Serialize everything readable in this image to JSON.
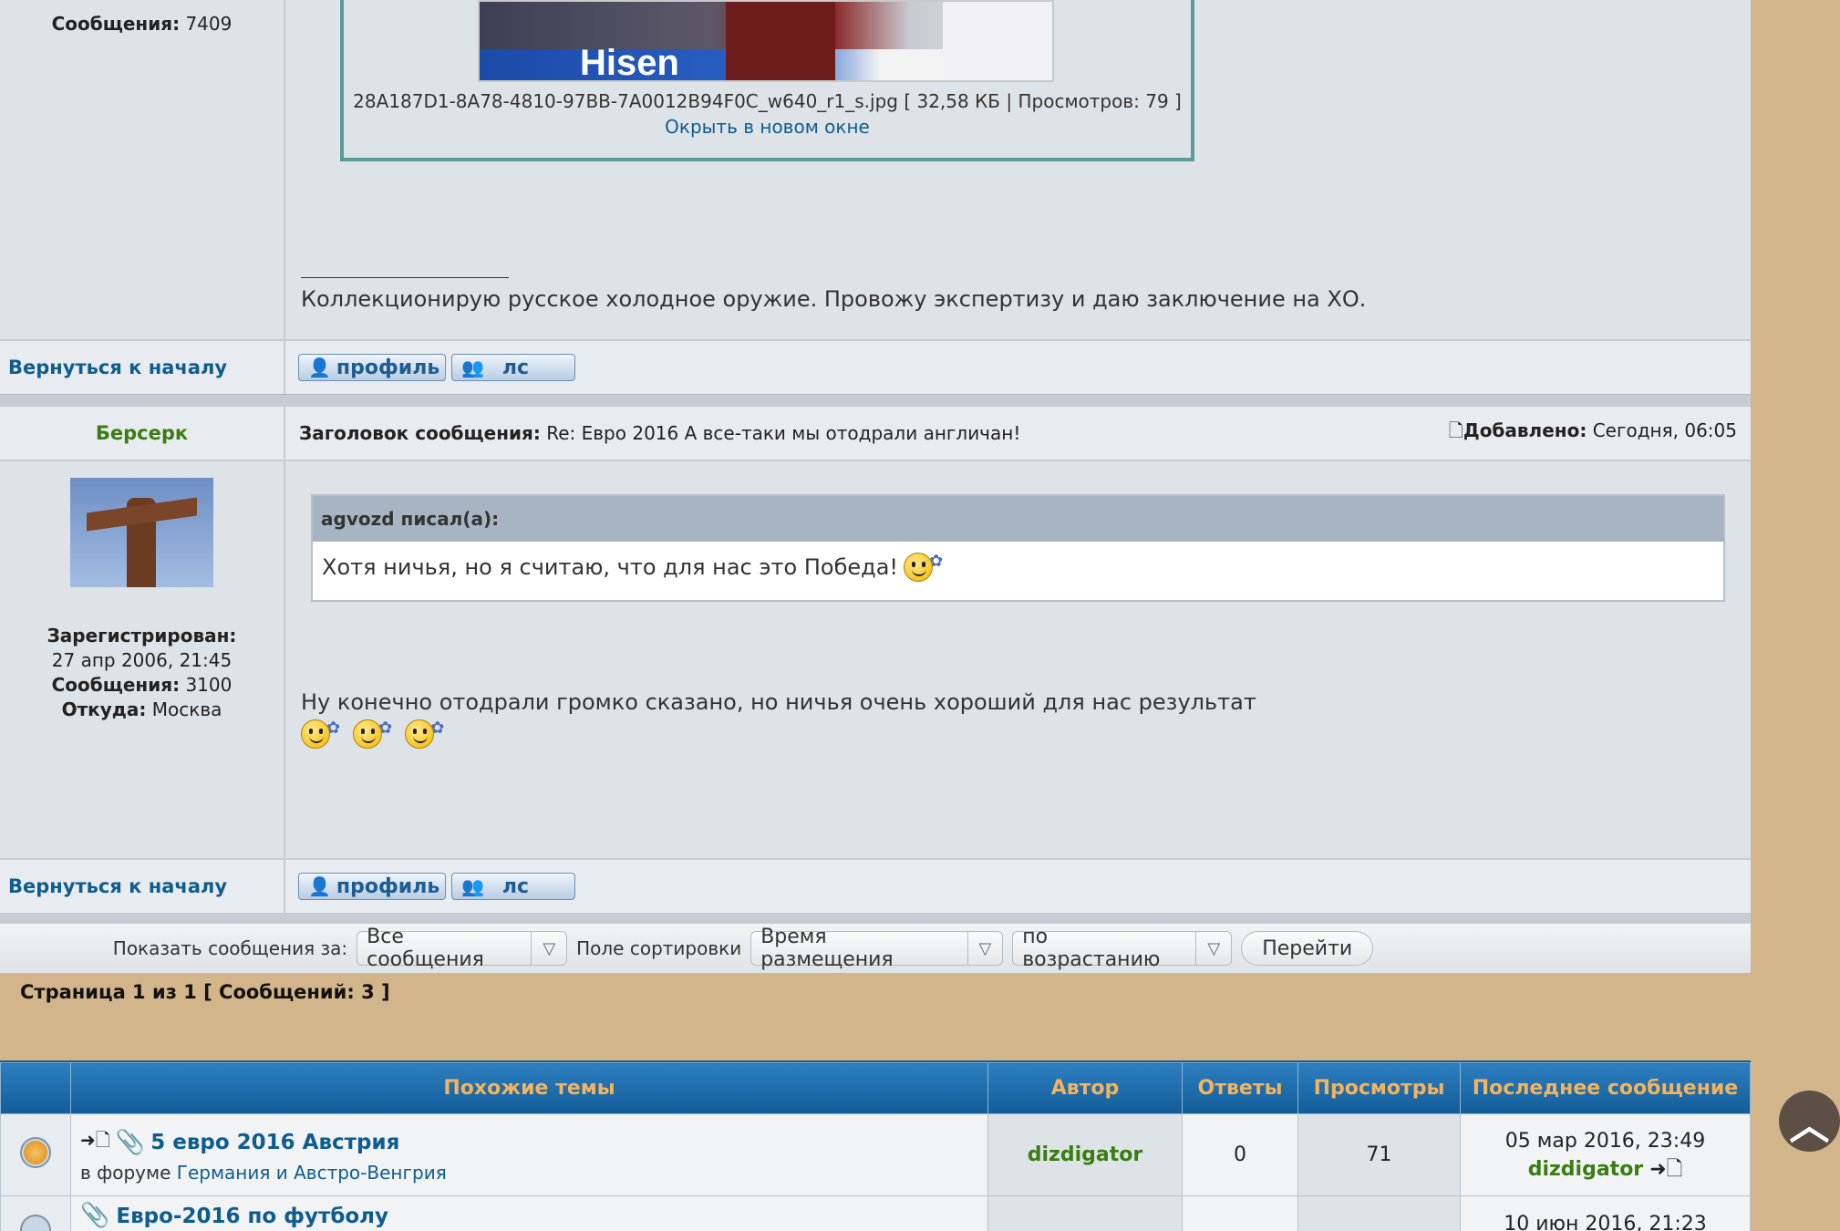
{
  "post1": {
    "stats_label": "Сообщения:",
    "stats_value": "7409",
    "attachment_caption": "28A187D1-8A78-4810-97BB-7A0012B94F0C_w640_r1_s.jpg [ 32,58 КБ | Просмотров: 79 ]",
    "open_new_window": "Окрыть в новом окне",
    "signature": "Коллекционирую русское холодное оружие. Провожу экспертизу и даю заключение на ХО.",
    "back_to_top": "Вернуться к началу",
    "profile_btn": "профиль",
    "pm_btn": "лс"
  },
  "post2": {
    "author": "Берсерк",
    "subject_label": "Заголовок сообщения:",
    "subject": "Re: Евро 2016 А все-таки мы отодрали англичан!",
    "added_label": "Добавлено:",
    "added_value": "Сегодня, 06:05",
    "registered_label": "Зарегистрирован:",
    "registered_value": "27 апр 2006, 21:45",
    "posts_label": "Сообщения:",
    "posts_value": "3100",
    "from_label": "Откуда:",
    "from_value": "Москва",
    "quote_author": "agvozd писал(а):",
    "quote_text": "Хотя ничья, но я считаю, что для нас это Победа!",
    "body_text": "Ну конечно отодрали громко сказано, но ничья очень хороший для нас результат",
    "back_to_top": "Вернуться к началу",
    "profile_btn": "профиль",
    "pm_btn": "лс"
  },
  "sortbar": {
    "show_label": "Показать сообщения за:",
    "show_value": "Все сообщения",
    "sort_label": "Поле сортировки",
    "sort_value": "Время размещения",
    "order_value": "по возрастанию",
    "go_button": "Перейти"
  },
  "pagination": "Страница 1 из 1 [ Сообщений: 3 ]",
  "similar": {
    "headers": [
      "Похожие темы",
      "Автор",
      "Ответы",
      "Просмотры",
      "Последнее сообщение"
    ],
    "rows": [
      {
        "title": "5 евро 2016 Австрия",
        "forum_prefix": "в форуме",
        "forum": "Германия и Австро-Венгрия",
        "author": "dizdigator",
        "replies": "0",
        "views": "71",
        "last_date": "05 мар 2016, 23:49",
        "last_author": "dizdigator"
      },
      {
        "title": "Евро-2016 по футболу",
        "last_date": "10 июн 2016, 21:23"
      }
    ]
  },
  "colors": {
    "accent_orange": "#f5b35b",
    "header_blue": "#1f6fae",
    "author_green": "#3a7d12",
    "link_blue": "#0f5d8f"
  }
}
